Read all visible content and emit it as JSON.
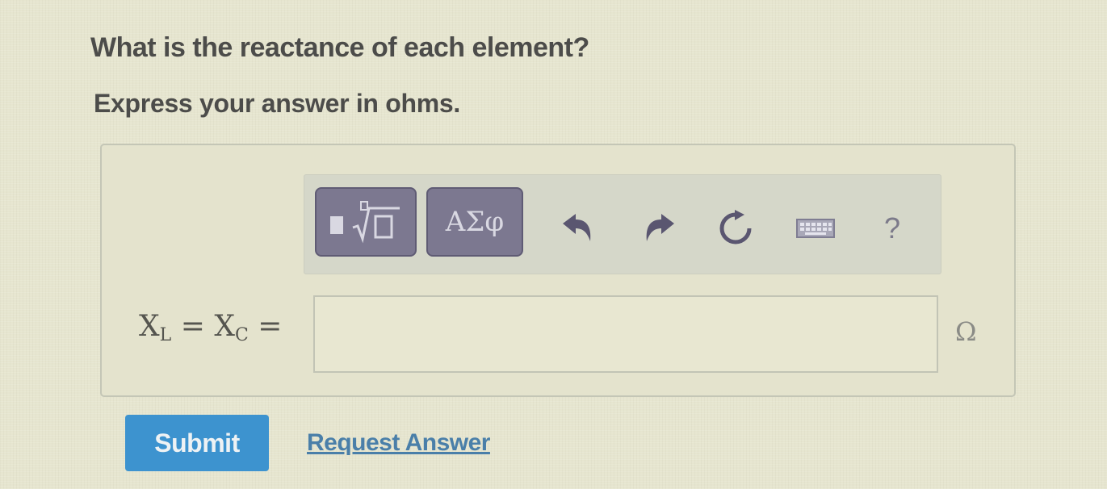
{
  "question": {
    "text": "What is the reactance of each element?",
    "instruction": "Express your answer in ohms."
  },
  "toolbar": {
    "symbols_label": "ΑΣφ",
    "help_label": "?",
    "icons": [
      "templates-icon",
      "undo-icon",
      "redo-icon",
      "reset-icon",
      "keyboard-icon",
      "help-icon"
    ]
  },
  "answer": {
    "lhs_var1": "X",
    "lhs_sub1": "L",
    "eq1": " = ",
    "lhs_var2": "X",
    "lhs_sub2": "C",
    "eq2": " =",
    "value": "",
    "unit": "Ω"
  },
  "actions": {
    "submit_label": "Submit",
    "request_label": "Request Answer"
  },
  "colors": {
    "background": "#e6e5cf",
    "toolbar_button": "#7c7890",
    "submit": "#3d93cf",
    "link": "#4a7fa9"
  }
}
